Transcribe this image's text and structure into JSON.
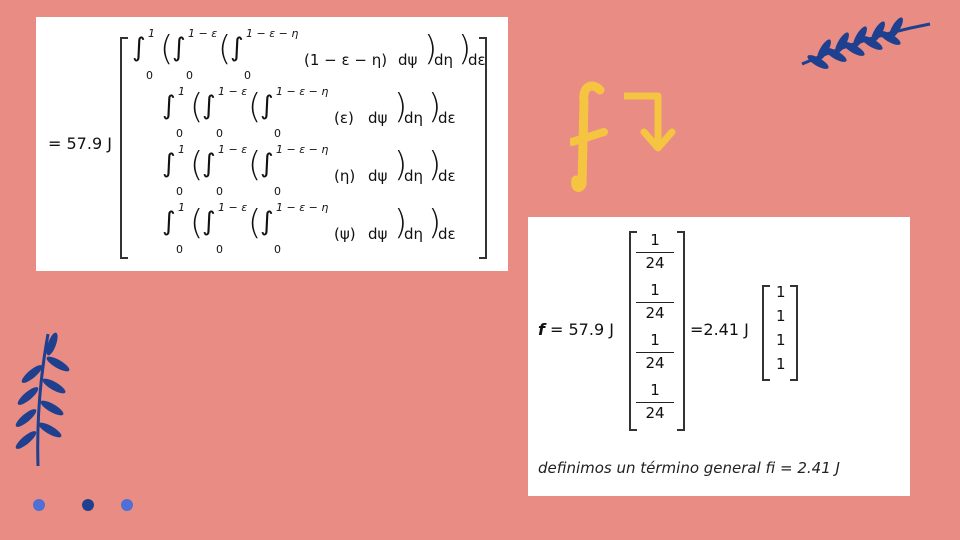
{
  "integrals_panel": {
    "prefix": "= 57.9 J",
    "upper_outer": "1",
    "upper_mid": "1 − ε",
    "upper_inner": "1 − ε − η",
    "lower": "0",
    "rows": [
      {
        "integrand": "(1 − ε − η)"
      },
      {
        "integrand": "(ε)"
      },
      {
        "integrand": "(η)"
      },
      {
        "integrand": "(ψ)"
      }
    ],
    "d_psi": "dψ",
    "d_eta": "dη",
    "d_eps": "dε"
  },
  "result_panel": {
    "f_symbol": "f",
    "f_prefix": "= 57.9 J",
    "fractions": [
      {
        "num": "1",
        "den": "24"
      },
      {
        "num": "1",
        "den": "24"
      },
      {
        "num": "1",
        "den": "24"
      },
      {
        "num": "1",
        "den": "24"
      }
    ],
    "equals_value": "=2.41 J",
    "unit_vector": [
      "1",
      "1",
      "1",
      "1"
    ],
    "note": "definimos un término general fi  =  2.41 J"
  },
  "decorations": {
    "handwritten_letter": "f",
    "accent_yellow": "#f5c542",
    "leaf_blue": "#1f3f8f",
    "dot_colors": [
      "#4f6fd6",
      "#1f3f8f",
      "#4f6fd6"
    ]
  }
}
